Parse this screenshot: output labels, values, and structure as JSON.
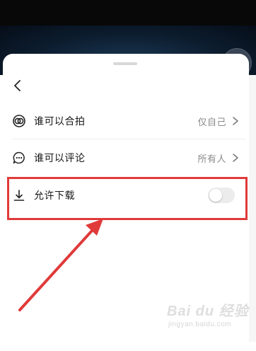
{
  "settings_sheet": {
    "rows": [
      {
        "label": "谁可以合拍",
        "value": "仅自己",
        "icon": "duet-icon"
      },
      {
        "label": "谁可以评论",
        "value": "所有人",
        "icon": "comment-icon"
      },
      {
        "label": "允许下载",
        "icon": "download-icon",
        "toggle_on": false
      }
    ]
  },
  "watermark": {
    "brand": "Bai du 经验",
    "sub": "jingyan.baidu.com"
  },
  "colors": {
    "highlight": "#e03a3a",
    "toggle_off": "#ececec",
    "text_primary": "#161616",
    "text_secondary": "#8a8a8a"
  }
}
